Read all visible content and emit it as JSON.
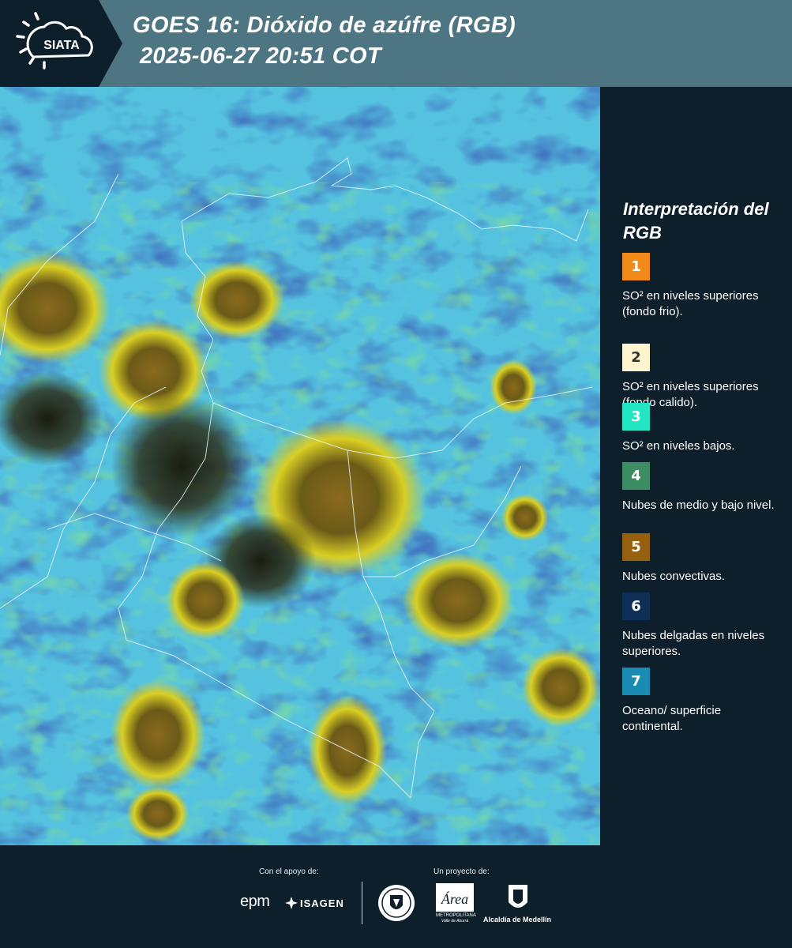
{
  "header": {
    "brand": "SIATA",
    "title_line1": "GOES 16: Dióxido de azúfre (RGB)",
    "title_line2": "2025-06-27 20:51 COT",
    "brand_color": "#4d7582"
  },
  "map": {
    "description_icon": "satellite-rgb-imagery"
  },
  "legend": {
    "title": "Interpretación del RGB",
    "items": [
      {
        "number": "1",
        "label": "SO² en niveles superiores (fondo frio).",
        "color": "#f28a1a",
        "text_color": "#ffffff"
      },
      {
        "number": "2",
        "label": "SO² en niveles superiores (fondo calido).",
        "color": "#fff6cf",
        "text_color": "#333333"
      },
      {
        "number": "3",
        "label": "SO² en niveles bajos.",
        "color": "#23e6c4",
        "text_color": "#ffffff"
      },
      {
        "number": "4",
        "label": "Nubes de medio y bajo nivel.",
        "color": "#3c8c64",
        "text_color": "#ffffff"
      },
      {
        "number": "5",
        "label": "Nubes convectivas.",
        "color": "#96600f",
        "text_color": "#ffffff"
      },
      {
        "number": "6",
        "label": "Nubes delgadas en niveles superiores.",
        "color": "#0d2f55",
        "text_color": "#ffffff"
      },
      {
        "number": "7",
        "label": "Oceano/ superficie continental.",
        "color": "#1a8cb4",
        "text_color": "#ffffff"
      }
    ]
  },
  "footer": {
    "support_caption": "Con el apoyo de:",
    "project_caption": "Un proyecto de:",
    "sponsor_1": "epm",
    "sponsor_2": "ISAGEN",
    "partner_area_line1": "METROPOLITANA",
    "partner_area_line2": "Valle de Aburrá",
    "partner_alcaldia": "Alcaldía de Medellín"
  }
}
